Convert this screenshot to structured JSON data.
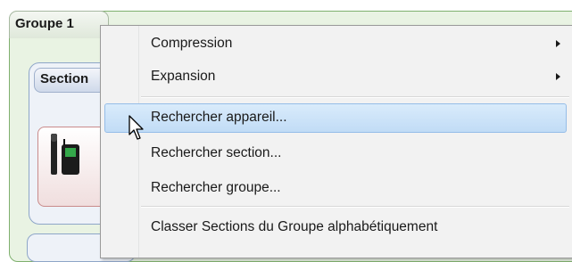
{
  "group": {
    "title": "Groupe 1"
  },
  "section": {
    "title": "Section"
  },
  "menu": {
    "items": [
      {
        "label": "Compression",
        "has_submenu": true
      },
      {
        "label": "Expansion",
        "has_submenu": true
      },
      {
        "label": "Rechercher appareil...",
        "highlighted": true
      },
      {
        "label": "Rechercher section..."
      },
      {
        "label": "Rechercher groupe..."
      },
      {
        "label": "Classer Sections du Groupe alphabétiquement"
      }
    ]
  },
  "colors": {
    "group_border": "#7fb06e",
    "section_border": "#8ea6c8",
    "highlight": "#c1dcf6",
    "menu_bg": "#f2f2f2"
  },
  "icons": {
    "device": "microphone-transmitter-icon",
    "cursor": "mouse-pointer-icon",
    "submenu": "submenu-arrow-icon"
  }
}
